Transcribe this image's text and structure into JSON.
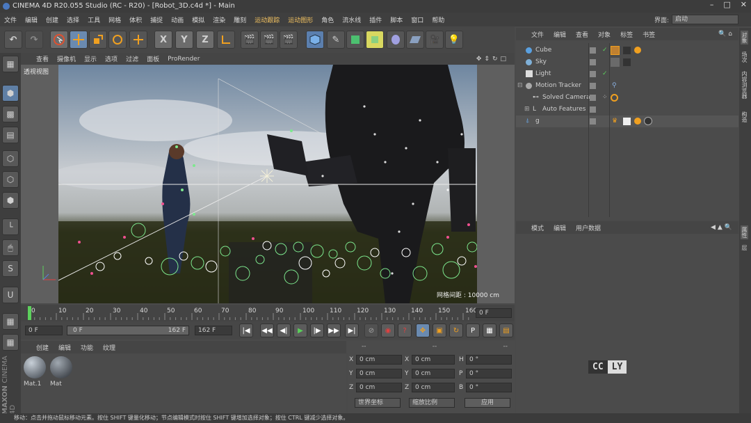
{
  "window": {
    "title": "CINEMA 4D R20.055 Studio (RC - R20) - [Robot_3D.c4d *] - Main",
    "controls": [
      "–",
      "□",
      "✕"
    ]
  },
  "menubar": {
    "items": [
      "文件",
      "编辑",
      "创建",
      "选择",
      "工具",
      "网格",
      "体积",
      "捕捉",
      "动画",
      "模拟",
      "渲染",
      "雕刻",
      "运动跟踪",
      "运动图形",
      "角色",
      "流水线",
      "插件",
      "脚本",
      "窗口",
      "帮助"
    ],
    "interface_label": "界面:",
    "interface_value": "启动"
  },
  "toolbar": {
    "axis_x": "X",
    "axis_y": "Y",
    "axis_z": "Z"
  },
  "viewport": {
    "menu": [
      "查看",
      "摄像机",
      "显示",
      "选项",
      "过滤",
      "面板",
      "ProRender"
    ],
    "label": "透视视图",
    "grid_info": "网格间距 : 10000 cm"
  },
  "timeline": {
    "ticks": [
      "0",
      "10",
      "20",
      "30",
      "40",
      "50",
      "60",
      "70",
      "80",
      "90",
      "100",
      "110",
      "120",
      "130",
      "140",
      "150",
      "160"
    ],
    "current_frame_right": "0 F",
    "start_frame": "0 F",
    "range_start": "0 F",
    "range_end": "162 F",
    "end_frame": "162 F",
    "playhead_frame": 0
  },
  "material_panel": {
    "menu": [
      "创建",
      "编辑",
      "功能",
      "纹理"
    ],
    "materials": [
      {
        "name": "Mat.1"
      },
      {
        "name": "Mat"
      }
    ]
  },
  "coord_panel": {
    "headers": [
      "--",
      "--",
      "--"
    ],
    "rows": [
      {
        "a": "X",
        "av": "0 cm",
        "b": "X",
        "bv": "0 cm",
        "c": "H",
        "cv": "0 °"
      },
      {
        "a": "Y",
        "av": "0 cm",
        "b": "Y",
        "bv": "0 cm",
        "c": "P",
        "cv": "0 °"
      },
      {
        "a": "Z",
        "av": "0 cm",
        "b": "Z",
        "bv": "0 cm",
        "c": "B",
        "cv": "0 °"
      }
    ],
    "coord_mode": "世界坐标",
    "scale_mode": "缩放比例",
    "apply": "应用"
  },
  "object_manager": {
    "menu": [
      "文件",
      "编辑",
      "查看",
      "对象",
      "标签",
      "书签"
    ],
    "objects": [
      {
        "name": "Cube"
      },
      {
        "name": "Sky"
      },
      {
        "name": "Light"
      },
      {
        "name": "Motion Tracker"
      },
      {
        "name": "Solved Camera"
      },
      {
        "name": "Auto Features"
      },
      {
        "name": "g"
      }
    ]
  },
  "attribute_manager": {
    "menu": [
      "模式",
      "编辑",
      "用户数据"
    ]
  },
  "right_tabs": [
    "对象",
    "场次",
    "内容浏览器",
    "构造",
    "属性",
    "层"
  ],
  "watermark": {
    "a": "CC",
    "b": "LY"
  },
  "branding": {
    "line1": "MAXON",
    "line2": "CINEMA 4D"
  },
  "statusbar": "移动：点击并拖动鼠标移动元素。按住 SHIFT 键量化移动；节点编辑模式时按住 SHIFT 键增加选择对象；按住 CTRL 键减少选择对象。",
  "colors": {
    "accent": "#f0a020",
    "selection": "#6aa0d8"
  }
}
